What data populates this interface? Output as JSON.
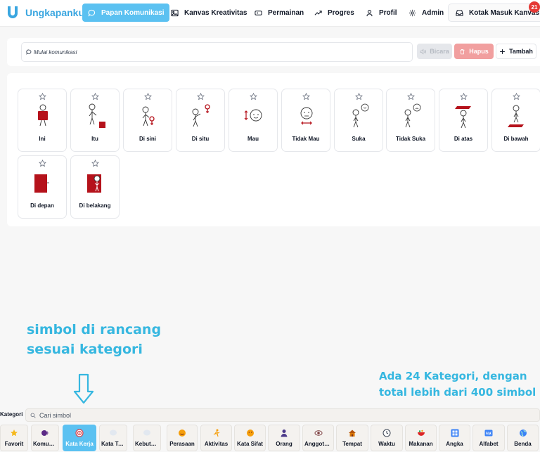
{
  "app": {
    "name": "Ungkapanku"
  },
  "nav": {
    "items": [
      {
        "label": "Papan Komunikasi",
        "icon": "chat-bubble-icon",
        "active": true
      },
      {
        "label": "Kanvas Kreativitas",
        "icon": "image-icon"
      },
      {
        "label": "Permainan",
        "icon": "gamepad-icon"
      },
      {
        "label": "Progres",
        "icon": "trending-up-icon"
      },
      {
        "label": "Profil",
        "icon": "user-icon"
      },
      {
        "label": "Admin",
        "icon": "gear-icon"
      },
      {
        "label": "Kotak Masuk Kanvas",
        "icon": "inbox-icon"
      }
    ],
    "inbox_badge": "21"
  },
  "composer": {
    "placeholder": "Mulai komunikasi",
    "speak_label": "Bicara",
    "clear_label": "Hapus",
    "add_label": "Tambah"
  },
  "board": {
    "symbols": [
      {
        "label": "Ini"
      },
      {
        "label": "Itu"
      },
      {
        "label": "Di sini"
      },
      {
        "label": "Di situ"
      },
      {
        "label": "Mau"
      },
      {
        "label": "Tidak Mau"
      },
      {
        "label": "Suka"
      },
      {
        "label": "Tidak Suka"
      },
      {
        "label": "Di atas"
      },
      {
        "label": "Di bawah"
      },
      {
        "label": "Di depan"
      },
      {
        "label": "Di belakang"
      }
    ]
  },
  "annotations": {
    "left_line1": "simbol di rancang",
    "left_line2": "sesuai kategori",
    "right_line1": "Ada 24 Kategori, dengan",
    "right_line2": "total lebih dari 400 simbol"
  },
  "categories": {
    "label": "Kategori",
    "search_placeholder": "Cari simbol",
    "items": [
      {
        "label": "Favorit",
        "icon": "star-icon",
        "color": "#f5b81c"
      },
      {
        "label": "Komunikasi",
        "icon": "speech-icon",
        "color": "#5b2a86"
      },
      {
        "label": "Kata Kerja",
        "icon": "target-icon",
        "color": "#d9434b",
        "active": true
      },
      {
        "label": "Kata Tanya",
        "icon": "question-bubble-icon",
        "color": "#cbd5e1"
      },
      {
        "label": "Kebutuhan",
        "icon": "need-bubble-icon",
        "color": "#cbd5e1"
      },
      {
        "label": "Perasaan",
        "icon": "smile-icon",
        "color": "#f59e0b"
      },
      {
        "label": "Aktivitas",
        "icon": "running-icon",
        "color": "#f59e0b"
      },
      {
        "label": "Kata Sifat",
        "icon": "face-icon",
        "color": "#f59e0b"
      },
      {
        "label": "Orang",
        "icon": "person-icon",
        "color": "#4c3a8a"
      },
      {
        "label": "Anggota Tubuh",
        "icon": "eye-icon",
        "color": "#7a3d3d"
      },
      {
        "label": "Tempat",
        "icon": "house-icon",
        "color": "#b45309"
      },
      {
        "label": "Waktu",
        "icon": "clock-icon",
        "color": "#374151"
      },
      {
        "label": "Makanan",
        "icon": "bowl-icon",
        "color": "#dc2626"
      },
      {
        "label": "Angka",
        "icon": "numbers-icon",
        "color": "#3b82f6"
      },
      {
        "label": "Alfabet",
        "icon": "abc-icon",
        "color": "#3b82f6"
      },
      {
        "label": "Benda",
        "icon": "globe-icon",
        "color": "#3b82f6"
      }
    ]
  },
  "colors": {
    "accent": "#5bc1f1",
    "brand": "#3aa6e0",
    "danger": "#f19f9f",
    "badge": "#e53935",
    "symbol_red": "#b5121b"
  }
}
